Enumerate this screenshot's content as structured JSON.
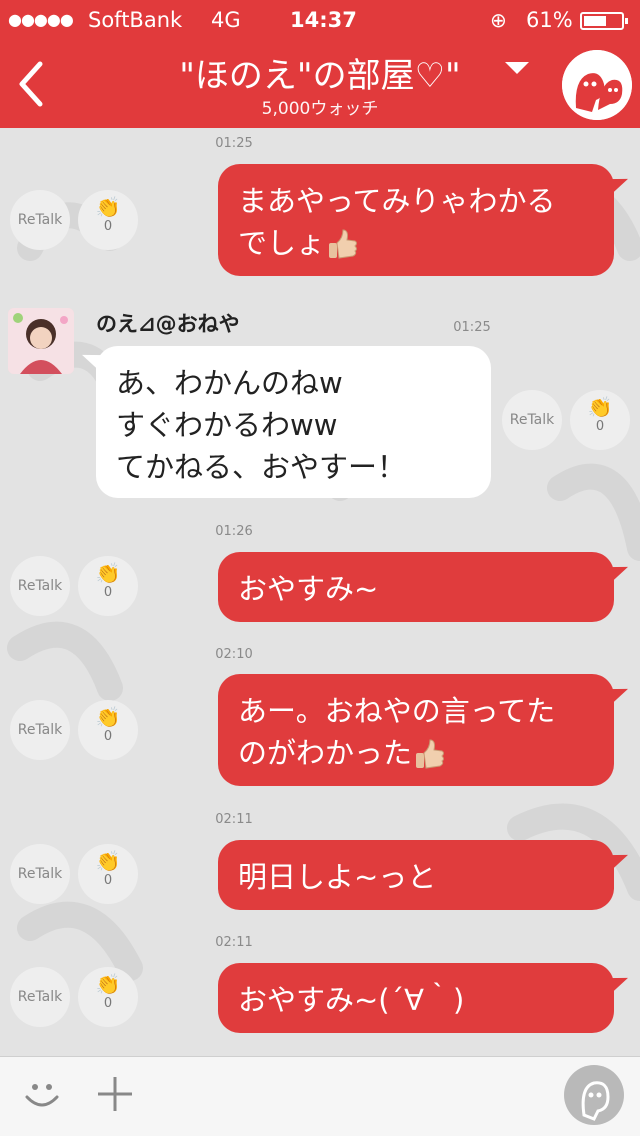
{
  "status": {
    "carrier": "SoftBank",
    "network": "4G",
    "time": "14:37",
    "battery": "61%",
    "battery_fraction": 0.61
  },
  "header": {
    "title": "\"ほのえ\"の部屋♡\"",
    "subtitle": "5,000ウォッチ"
  },
  "messages": [
    {
      "time": "01:25",
      "text1": "まあやってみりゃわかる",
      "text2": "でしょ",
      "retalk": "ReTalk",
      "claps": "0"
    },
    {
      "sender": "のえ⊿@おねや",
      "time": "01:25",
      "lines": [
        "あ、わかんのねw",
        "すぐわかるわww",
        "てかねる、おやすー！"
      ],
      "retalk": "ReTalk",
      "claps": "0"
    },
    {
      "time": "01:26",
      "text": "おやすみ~",
      "retalk": "ReTalk",
      "claps": "0"
    },
    {
      "time": "02:10",
      "text1": "あー。おねやの言ってた",
      "text2": "のがわかった",
      "retalk": "ReTalk",
      "claps": "0"
    },
    {
      "time": "02:11",
      "text": "明日しよ~っと",
      "retalk": "ReTalk",
      "claps": "0"
    },
    {
      "time": "02:11",
      "text": "おやすみ~(´∀｀)",
      "retalk": "ReTalk",
      "claps": "0"
    }
  ],
  "colors": {
    "accent": "#e13a3c",
    "background": "#e3e3e3"
  }
}
